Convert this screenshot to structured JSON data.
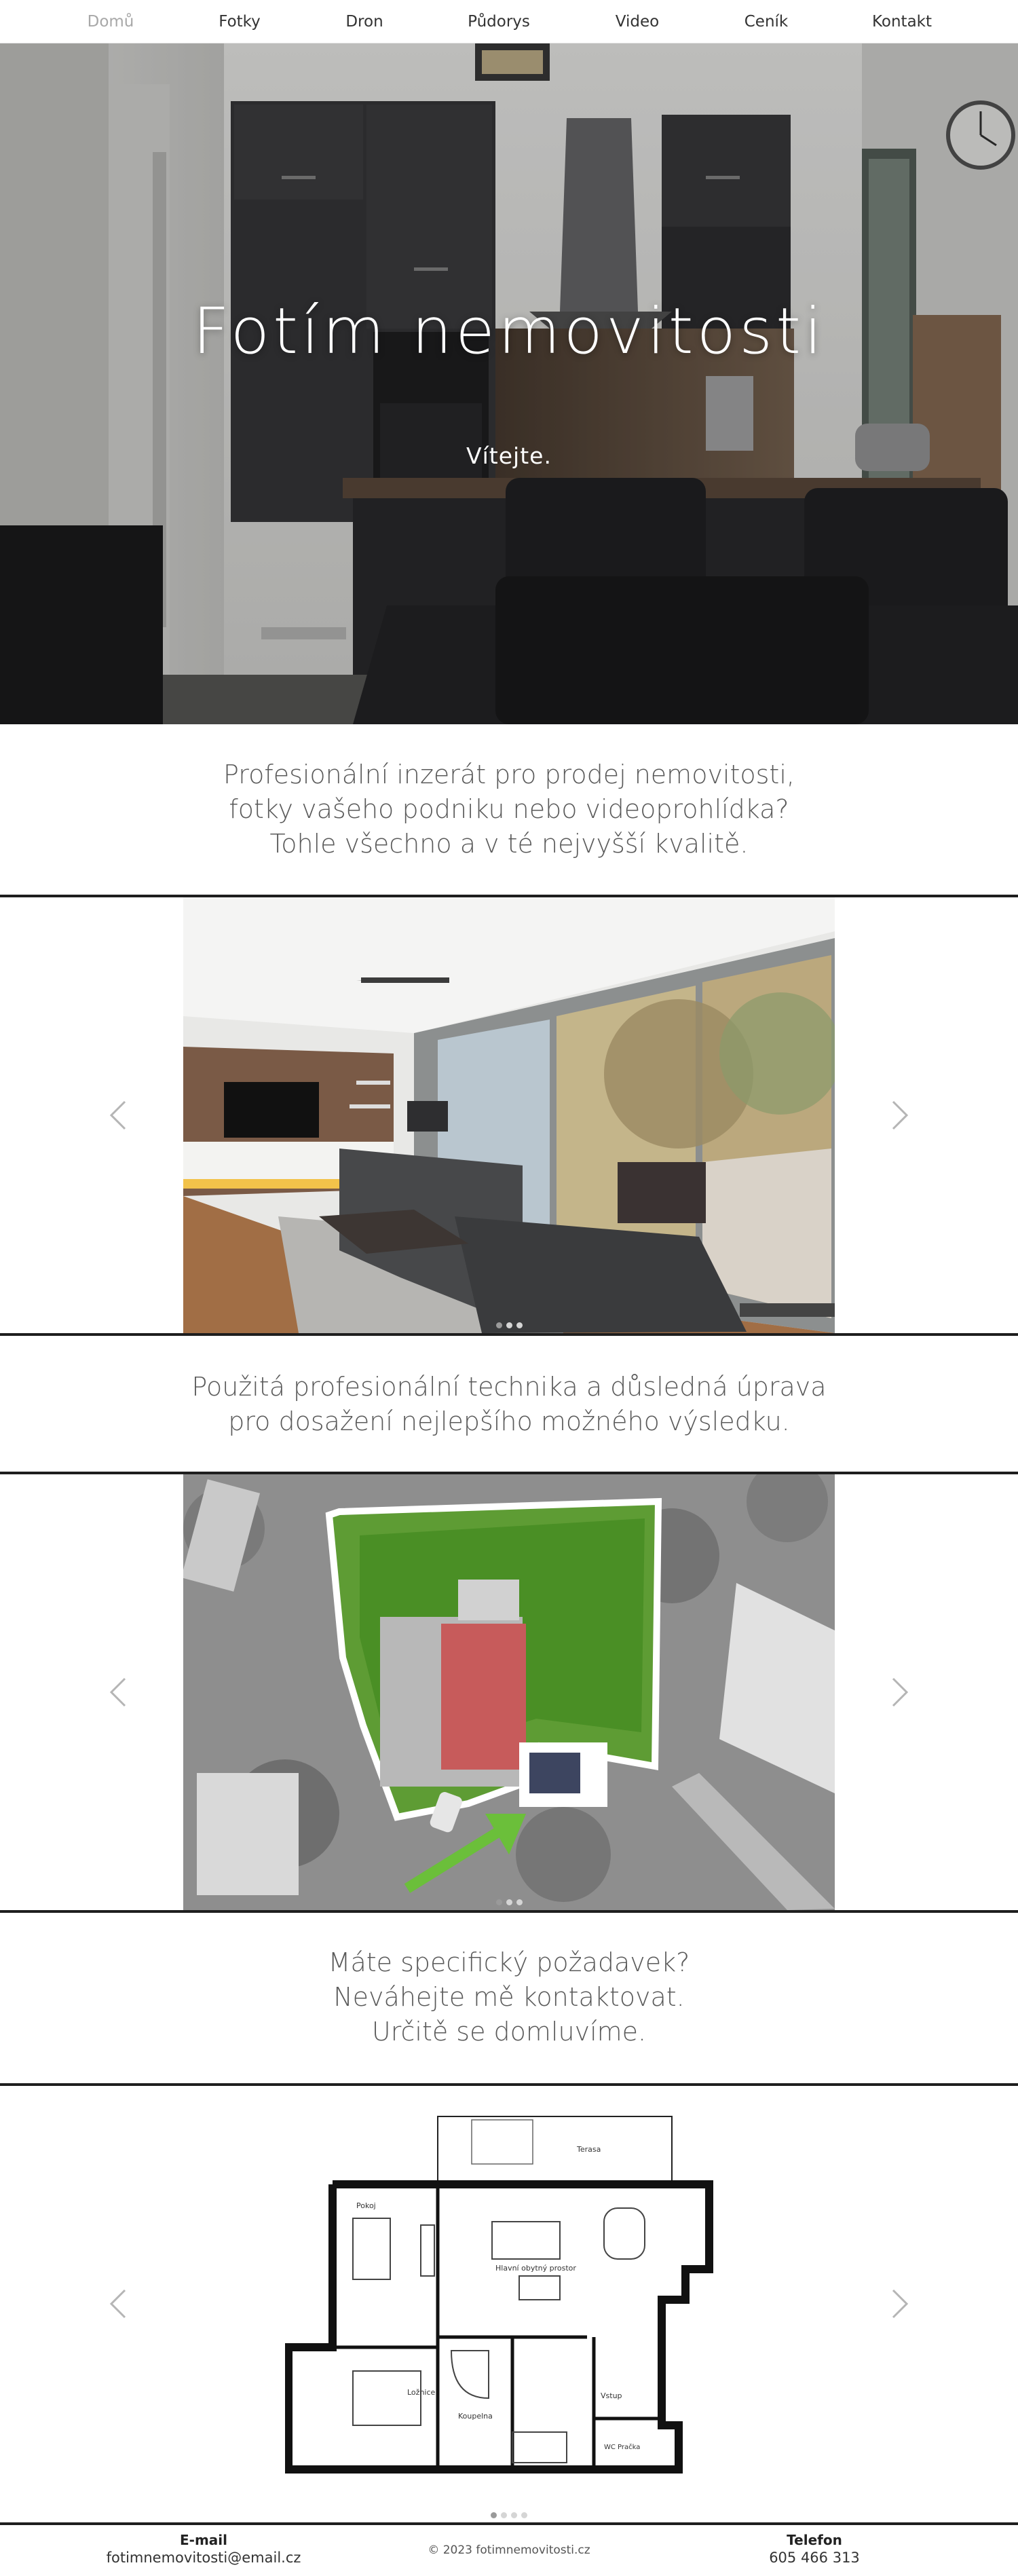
{
  "nav": {
    "items": [
      {
        "label": "Domů",
        "active": true
      },
      {
        "label": "Fotky",
        "active": false
      },
      {
        "label": "Dron",
        "active": false
      },
      {
        "label": "Půdorys",
        "active": false
      },
      {
        "label": "Video",
        "active": false
      },
      {
        "label": "Ceník",
        "active": false
      },
      {
        "label": "Kontakt",
        "active": false
      }
    ]
  },
  "hero": {
    "title": "Fotím nemovitosti",
    "subtitle": "Vítejte."
  },
  "intro": {
    "lines": [
      "Profesionální inzerát pro prodej nemovitosti,",
      "fotky vašeho podniku nebo videoprohlídka?",
      "Tohle všechno a v té nejvyšší kvalitě."
    ]
  },
  "photo_slider": {
    "prev_icon": "chevron-left-icon",
    "next_icon": "chevron-right-icon",
    "dots": 3,
    "active_dot": 0
  },
  "technique": {
    "lines": [
      "Použitá profesionální technika a důsledná úprava",
      "pro dosažení nejlepšího možného výsledku."
    ]
  },
  "drone_slider": {
    "prev_icon": "chevron-left-icon",
    "next_icon": "chevron-right-icon",
    "dots": 3,
    "active_dot": 0
  },
  "contact_cta": {
    "lines": [
      "Máte specifický požadavek?",
      "Neváhejte mě kontaktovat.",
      "Určitě se domluvíme."
    ]
  },
  "floorplan_slider": {
    "prev_icon": "chevron-left-icon",
    "next_icon": "chevron-right-icon",
    "dots": 4,
    "active_dot": 0,
    "room_labels": {
      "terasa": "Terasa",
      "pokoj": "Pokoj",
      "obytny": "Hlavní obytný prostor",
      "loznice": "Ložnice",
      "koupelna": "Koupelna",
      "vstup": "Vstup",
      "wc": "WC Pračka"
    }
  },
  "footer": {
    "email_label": "E-mail",
    "email_value": "fotimnemovitosti@email.cz",
    "copyright": "© 2023 fotimnemovitosti.cz",
    "phone_label": "Telefon",
    "phone_value": "605 466 313"
  },
  "colors": {
    "nav_active": "#a8a8a8",
    "text": "#5a5a5a",
    "rule": "#1e1e1e",
    "drone_arrow": "#6bbf3a",
    "plot_outline": "#ffffff"
  }
}
